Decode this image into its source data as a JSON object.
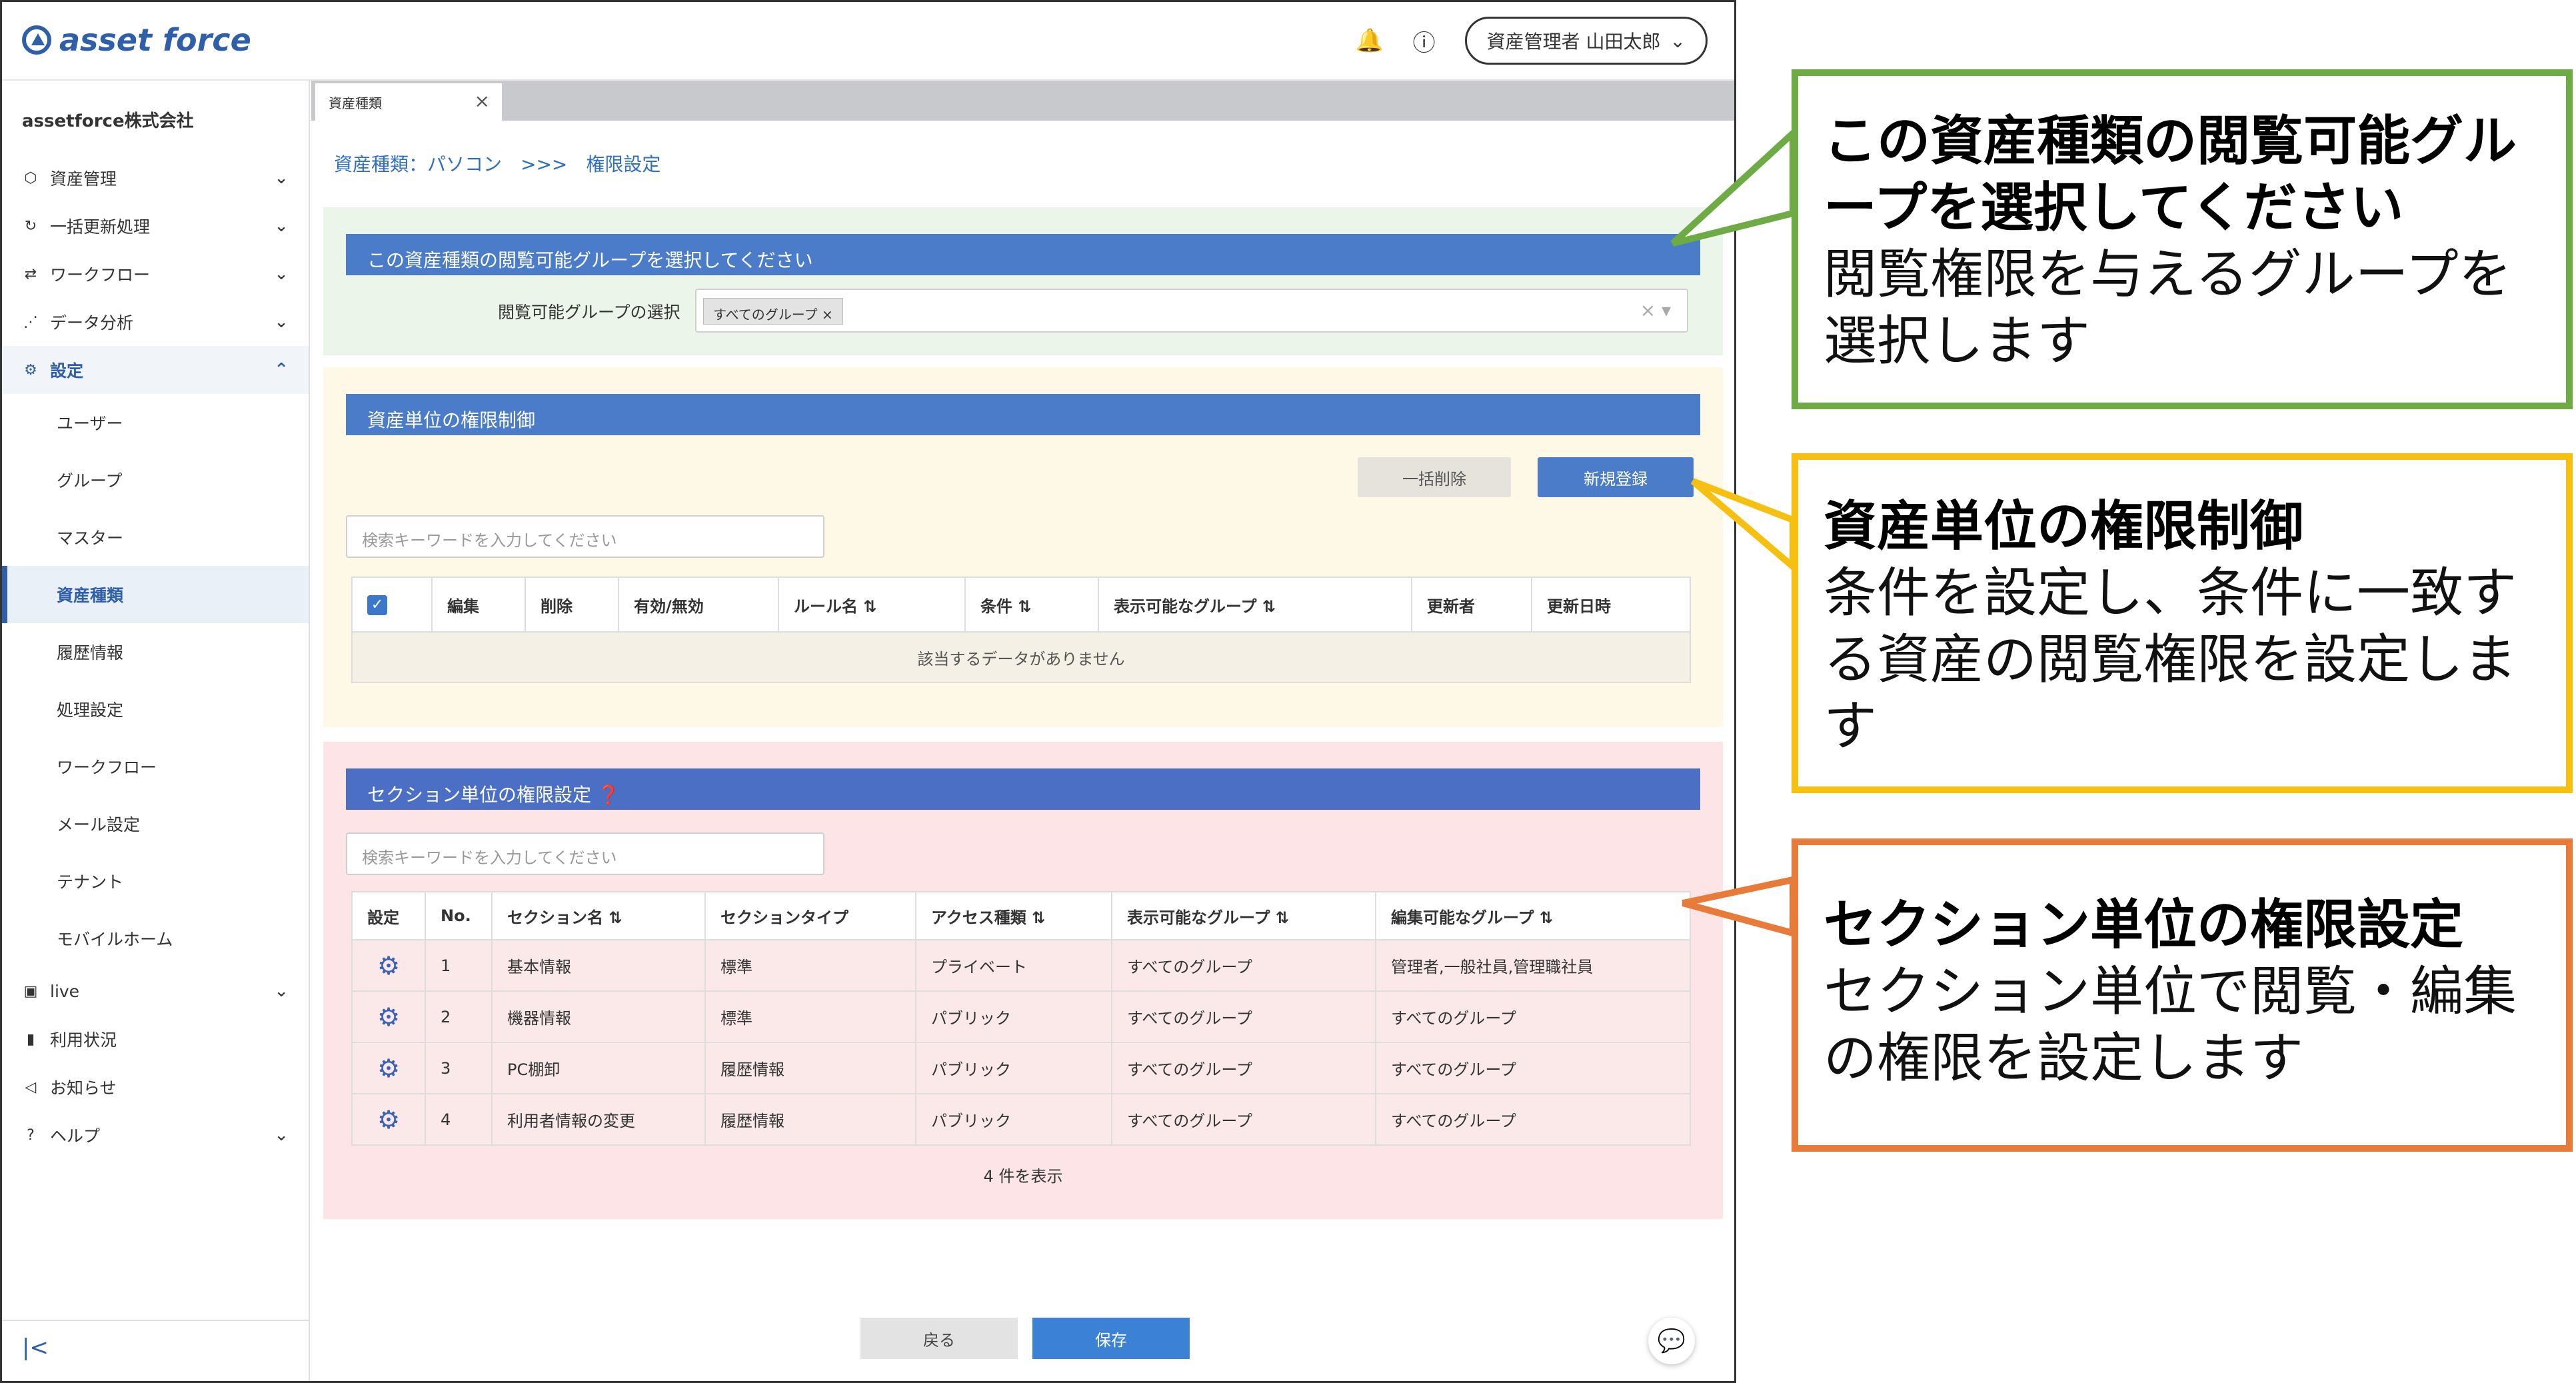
{
  "app": {
    "logo": "asset force"
  },
  "topbar": {
    "user_label": "資産管理者 山田太郎",
    "bell_icon": "bell-icon",
    "help_icon": "help-icon"
  },
  "sidebar": {
    "company": "assetforce株式会社",
    "items": [
      {
        "label": "資産管理",
        "icon": "cube-icon"
      },
      {
        "label": "一括更新処理",
        "icon": "refresh-icon"
      },
      {
        "label": "ワークフロー",
        "icon": "workflow-icon"
      },
      {
        "label": "データ分析",
        "icon": "analytics-icon"
      },
      {
        "label": "設定",
        "icon": "gear-icon"
      }
    ],
    "sub_items": [
      "ユーザー",
      "グループ",
      "マスター",
      "資産種類",
      "履歴情報",
      "処理設定",
      "ワークフロー",
      "メール設定",
      "テナント",
      "モバイルホーム"
    ],
    "bottom_items": [
      {
        "label": "live",
        "icon": "live-icon"
      },
      {
        "label": "利用状況",
        "icon": "chart-icon"
      },
      {
        "label": "お知らせ",
        "icon": "megaphone-icon"
      },
      {
        "label": "ヘルプ",
        "icon": "help-icon"
      }
    ]
  },
  "tab": {
    "label": "資産種類"
  },
  "breadcrumb": "資産種類：パソコン　>>>　権限設定",
  "panel1": {
    "title": "この資産種類の閲覧可能グループを選択してください",
    "label": "閲覧可能グループの選択",
    "chip": "すべてのグループ"
  },
  "panel2": {
    "title": "資産単位の権限制御",
    "delete_label": "一括削除",
    "new_label": "新規登録",
    "search_placeholder": "検索キーワードを入力してください",
    "columns": [
      "編集",
      "削除",
      "有効/無効",
      "ルール名 ⇅",
      "条件 ⇅",
      "表示可能なグループ ⇅",
      "更新者",
      "更新日時"
    ],
    "empty": "該当するデータがありません"
  },
  "panel3": {
    "title": "セクション単位の権限設定",
    "search_placeholder": "検索キーワードを入力してください",
    "columns": [
      "設定",
      "No.",
      "セクション名 ⇅",
      "セクションタイプ",
      "アクセス種類 ⇅",
      "表示可能なグループ ⇅",
      "編集可能なグループ ⇅"
    ],
    "rows": [
      [
        "1",
        "基本情報",
        "標準",
        "プライベート",
        "すべてのグループ",
        "管理者,一般社員,管理職社員"
      ],
      [
        "2",
        "機器情報",
        "標準",
        "パブリック",
        "すべてのグループ",
        "すべてのグループ"
      ],
      [
        "3",
        "PC棚卸",
        "履歴情報",
        "パブリック",
        "すべてのグループ",
        "すべてのグループ"
      ],
      [
        "4",
        "利用者情報の変更",
        "履歴情報",
        "パブリック",
        "すべてのグループ",
        "すべてのグループ"
      ]
    ],
    "count": "4 件を表示"
  },
  "footer": {
    "back": "戻る",
    "save": "保存"
  },
  "callouts": [
    {
      "title": "この資産種類の閲覧可能グループを選択してください",
      "desc": "閲覧権限を与えるグループを選択します",
      "color": "#6fab45"
    },
    {
      "title": "資産単位の権限制御",
      "desc": "条件を設定し、条件に一致する資産の閲覧権限を設定します",
      "color": "#f5c00f"
    },
    {
      "title": "セクション単位の権限設定",
      "desc": "セクション単位で閲覧・編集の権限を設定します",
      "color": "#e87b3a"
    }
  ]
}
